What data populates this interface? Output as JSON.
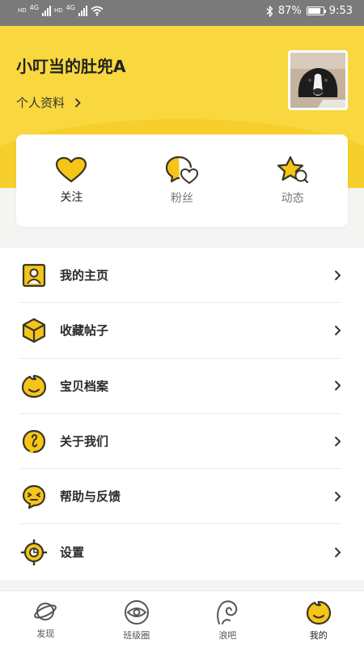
{
  "status_bar": {
    "network_left": "HD",
    "network_right": "HD",
    "net1": "4G",
    "net2": "4G",
    "battery": "87%",
    "time": "9:53"
  },
  "profile": {
    "username": "小叮当的肚兜A",
    "profile_link": "个人资料"
  },
  "stats": [
    {
      "label": "关注",
      "icon": "heart-icon"
    },
    {
      "label": "粉丝",
      "icon": "fans-bubble-heart-icon"
    },
    {
      "label": "动态",
      "icon": "star-search-icon"
    }
  ],
  "menu": [
    {
      "label": "我的主页",
      "icon": "person-card-icon"
    },
    {
      "label": "收藏帖子",
      "icon": "box-icon"
    },
    {
      "label": "宝贝档案",
      "icon": "baby-face-icon"
    },
    {
      "label": "关于我们",
      "icon": "about-us-icon"
    },
    {
      "label": "帮助与反馈",
      "icon": "help-feedback-icon"
    },
    {
      "label": "设置",
      "icon": "settings-icon"
    }
  ],
  "tabs": [
    {
      "label": "发现",
      "icon": "planet-icon"
    },
    {
      "label": "班级圈",
      "icon": "class-circle-icon"
    },
    {
      "label": "浪吧",
      "icon": "wave-icon"
    },
    {
      "label": "我的",
      "icon": "me-face-icon"
    }
  ],
  "colors": {
    "brand_yellow": "#f8d73f",
    "icon_yellow": "#f5c518",
    "icon_stroke": "#3a3526"
  }
}
